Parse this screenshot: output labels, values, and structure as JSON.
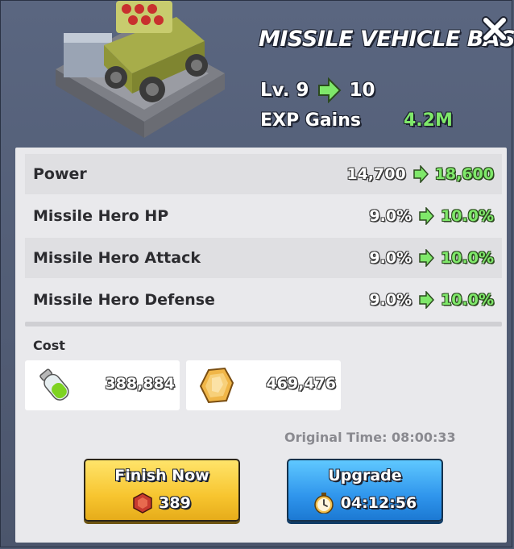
{
  "header": {
    "title": "MISSILE VEHICLE BASE",
    "level_label": "Lv. 9",
    "level_next": "10",
    "exp_label": "EXP Gains",
    "exp_value": "4.2M"
  },
  "stats": [
    {
      "name": "Power",
      "from": "14,700",
      "to": "18,600"
    },
    {
      "name": "Missile Hero HP",
      "from": "9.0%",
      "to": "10.0%"
    },
    {
      "name": "Missile Hero Attack",
      "from": "9.0%",
      "to": "10.0%"
    },
    {
      "name": "Missile Hero Defense",
      "from": "9.0%",
      "to": "10.0%"
    }
  ],
  "cost": {
    "label": "Cost",
    "items": [
      {
        "icon": "potion-vial-icon",
        "amount": "388,884"
      },
      {
        "icon": "gold-ore-icon",
        "amount": "469,476"
      }
    ]
  },
  "original_time": "Original Time: 08:00:33",
  "buttons": {
    "finish": {
      "label": "Finish Now",
      "icon": "gem-icon",
      "value": "389"
    },
    "upgrade": {
      "label": "Upgrade",
      "icon": "stopwatch-icon",
      "value": "04:12:56"
    }
  },
  "colors": {
    "green": "#7fe86a",
    "finish_button": "#f7c52f",
    "upgrade_button": "#2f95ec",
    "panel": "#e9e9ec"
  }
}
